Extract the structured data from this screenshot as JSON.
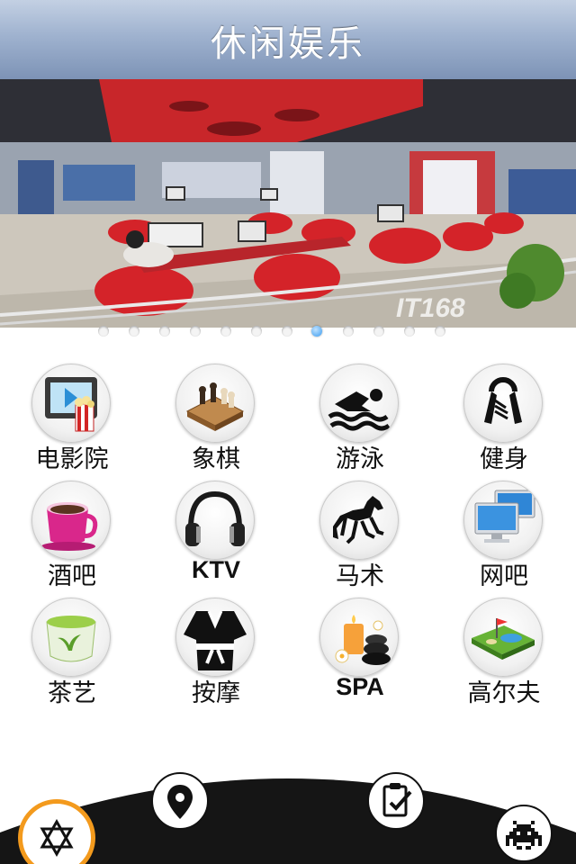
{
  "header": {
    "title": "休闲娱乐"
  },
  "banner": {
    "watermark": "IT168",
    "slide_count": 12,
    "active_slide_index": 7
  },
  "grid": {
    "items": [
      {
        "label": "电影院",
        "icon": "movie-icon"
      },
      {
        "label": "象棋",
        "icon": "chess-icon"
      },
      {
        "label": "游泳",
        "icon": "swimming-icon"
      },
      {
        "label": "健身",
        "icon": "hand-gripper-icon"
      },
      {
        "label": "酒吧",
        "icon": "coffee-cup-icon"
      },
      {
        "label": "KTV",
        "icon": "headphones-icon"
      },
      {
        "label": "马术",
        "icon": "horse-icon"
      },
      {
        "label": "网吧",
        "icon": "computer-monitor-icon"
      },
      {
        "label": "茶艺",
        "icon": "tea-cup-icon"
      },
      {
        "label": "按摩",
        "icon": "robe-icon"
      },
      {
        "label": "SPA",
        "icon": "spa-candle-icon"
      },
      {
        "label": "高尔夫",
        "icon": "golf-course-icon"
      }
    ]
  },
  "tabbar": {
    "items": [
      {
        "icon": "star-of-david-icon",
        "selected": true
      },
      {
        "icon": "map-pin-icon",
        "selected": false
      },
      {
        "icon": "clipboard-check-icon",
        "selected": false
      },
      {
        "icon": "space-invader-icon",
        "selected": false
      }
    ],
    "accent_color": "#f39a1d",
    "bar_color": "#151515"
  }
}
